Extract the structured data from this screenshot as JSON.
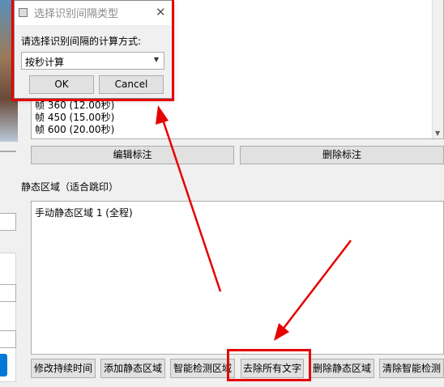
{
  "frame_list": {
    "rows": [
      "帧 360 (12.00秒)",
      "帧 450 (15.00秒)",
      "帧 600 (20.00秒)"
    ]
  },
  "annotation_buttons": {
    "edit_label": "编辑标注",
    "delete_label": "删除标注"
  },
  "static_regions": {
    "label": "静态区域（适合跳印）",
    "items": [
      "手动静态区域 1 (全程)"
    ]
  },
  "bottom_buttons": {
    "modify_duration": "修改持续时间",
    "add_static": "添加静态区域",
    "smart_detect": "智能检测区域",
    "remove_all_text": "去除所有文字",
    "delete_static": "删除静态区域",
    "clear_smart": "清除智能检测"
  },
  "dialog": {
    "title": "选择识别间隔类型",
    "prompt": "请选择识别间隔的计算方式:",
    "selected_option": "按秒计算",
    "ok_label": "OK",
    "cancel_label": "Cancel"
  },
  "colors": {
    "highlight": "#e60000",
    "accent": "#0078d7"
  }
}
